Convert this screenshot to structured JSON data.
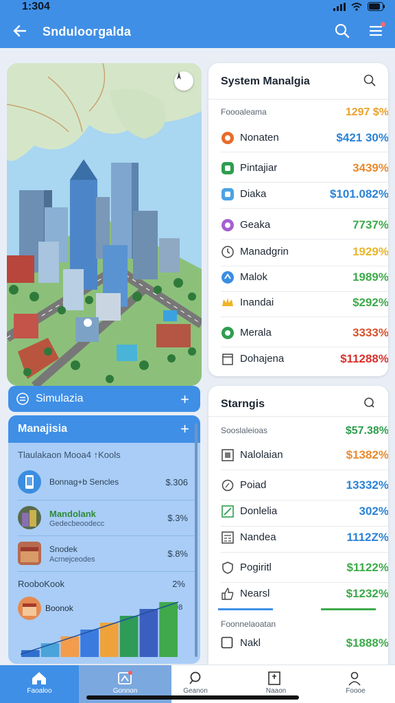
{
  "status": {
    "time": "1:304"
  },
  "appbar": {
    "title": "Sndulоогgalda"
  },
  "sim_bar": {
    "label": "Simulazia"
  },
  "management": {
    "title": "Manajisia",
    "subtitle": "Tlaulakaon Mooa4 ↑Kools",
    "rows": [
      {
        "line1": "Bonnag+b Sencles",
        "line2": "",
        "value": "$.306"
      },
      {
        "line1": "Mandolank",
        "line2": "Gedecbeoodecc",
        "value": "$.3%"
      },
      {
        "line1": "Snodek",
        "line2": "Acrnejceodes",
        "value": "$.8%"
      }
    ],
    "foot_label": "RooboKook",
    "foot_value": "2%",
    "chart_label": "Boonok",
    "chart_value": "98",
    "chart_data": {
      "type": "bar",
      "values": [
        1,
        2,
        3,
        4,
        5,
        6,
        7,
        8
      ],
      "colors": [
        "#2f6fcf",
        "#4aa3d9",
        "#f39c4b",
        "#3b7be0",
        "#f0a23a",
        "#2e9b57",
        "#3b5fc0",
        "#3fa94c"
      ]
    }
  },
  "system_card": {
    "title": "System Manаlgia",
    "header_label": "Foooaleama",
    "header_value": "1297 $%",
    "rows": [
      {
        "icon": "orange-circle-icon",
        "color": "#e86b2a",
        "label": "Nonaten",
        "value": "$421 30%",
        "vcolor": "#2b83d6"
      },
      {
        "icon": "green-square-icon",
        "color": "#2e9d4f",
        "label": "Pintajiar",
        "value": "3439%",
        "vcolor": "#ea8a2d"
      },
      {
        "icon": "blue-square-icon",
        "color": "#4aa3e4",
        "label": "Diaka",
        "value": "$101.082%",
        "vcolor": "#2b83d6"
      },
      {
        "icon": "purple-circle-icon",
        "color": "#a55fd0",
        "label": "Geaka",
        "value": "7737%",
        "vcolor": "#3daa4a"
      },
      {
        "icon": "clock-icon",
        "color": "#555",
        "label": "Manadgrin",
        "value": "1929%",
        "vcolor": "#e9b52c"
      },
      {
        "icon": "blue-gear-icon",
        "color": "#3b8de0",
        "label": "Malok",
        "value": "1989%",
        "vcolor": "#3daa4a"
      },
      {
        "icon": "crown-icon",
        "color": "#f0b429",
        "label": "Inandai",
        "value": "$292%",
        "vcolor": "#3daa4a"
      },
      {
        "icon": "green-circle-icon",
        "color": "#2e9d4f",
        "label": "Merala",
        "value": "3333%",
        "vcolor": "#d9512c"
      },
      {
        "icon": "document-icon",
        "color": "#555",
        "label": "Dohajena",
        "value": "$11288%",
        "vcolor": "#d9312c"
      }
    ]
  },
  "settings_card": {
    "title": "Starngis",
    "header_label": "Sooslaleioas",
    "header_value": "$57.38%",
    "rows": [
      {
        "icon": "frame-icon",
        "label": "Nalolaian",
        "value": "$1382%",
        "vcolor": "#ea8a2d"
      },
      {
        "icon": "pin-icon",
        "label": "Poiad",
        "value": "13332%",
        "vcolor": "#2b83d6"
      },
      {
        "icon": "edit-icon",
        "label": "Donlelia",
        "value": "302%",
        "vcolor": "#2b83d6"
      },
      {
        "icon": "calculator-icon",
        "label": "Nandea",
        "value": "1112Z%",
        "vcolor": "#2b83d6"
      },
      {
        "icon": "shield-icon",
        "label": "Pogiritl",
        "value": "$1122%",
        "vcolor": "#3daa4a"
      },
      {
        "icon": "thumb-icon",
        "label": "Nearsl",
        "value": "$1232%",
        "vcolor": "#3daa4a"
      }
    ],
    "section2_label": "Foonnelaoatan",
    "last_row": {
      "icon": "checkbox-icon",
      "label": "Nakl",
      "value": "$1888%",
      "vcolor": "#3daa4a"
    }
  },
  "bottom_nav": [
    {
      "label": "Faoaloo",
      "icon": "home-icon"
    },
    {
      "label": "Gonnon",
      "icon": "map-icon"
    },
    {
      "label": "Geanon",
      "icon": "search-icon"
    },
    {
      "label": "Naaon",
      "icon": "building-icon"
    },
    {
      "label": "Foooe",
      "icon": "profile-icon"
    }
  ],
  "colors": {
    "accent": "#3f8fe6",
    "panel": "#a9cdf6"
  }
}
